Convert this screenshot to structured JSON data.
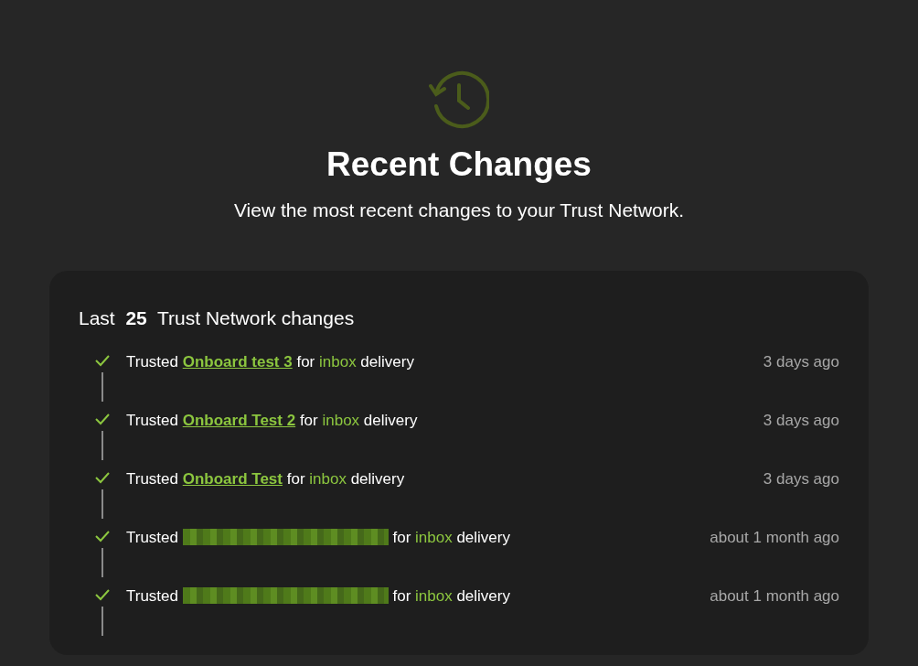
{
  "header": {
    "title": "Recent Changes",
    "subtitle": "View the most recent changes to your Trust Network."
  },
  "card": {
    "title_prefix": "Last",
    "count": "25",
    "title_suffix": "Trust Network changes"
  },
  "changes": [
    {
      "action": "Trusted",
      "subject": {
        "kind": "link",
        "text": "Onboard test 3"
      },
      "connector": "for",
      "channel": "inbox",
      "suffix": "delivery",
      "time": "3 days ago"
    },
    {
      "action": "Trusted",
      "subject": {
        "kind": "link",
        "text": "Onboard Test 2"
      },
      "connector": "for",
      "channel": "inbox",
      "suffix": "delivery",
      "time": "3 days ago"
    },
    {
      "action": "Trusted",
      "subject": {
        "kind": "link",
        "text": "Onboard Test"
      },
      "connector": "for",
      "channel": "inbox",
      "suffix": "delivery",
      "time": "3 days ago"
    },
    {
      "action": "Trusted",
      "subject": {
        "kind": "redacted"
      },
      "connector": "for",
      "channel": "inbox",
      "suffix": "delivery",
      "time": "about 1 month ago"
    },
    {
      "action": "Trusted",
      "subject": {
        "kind": "redacted"
      },
      "connector": "for",
      "channel": "inbox",
      "suffix": "delivery",
      "time": "about 1 month ago"
    }
  ]
}
